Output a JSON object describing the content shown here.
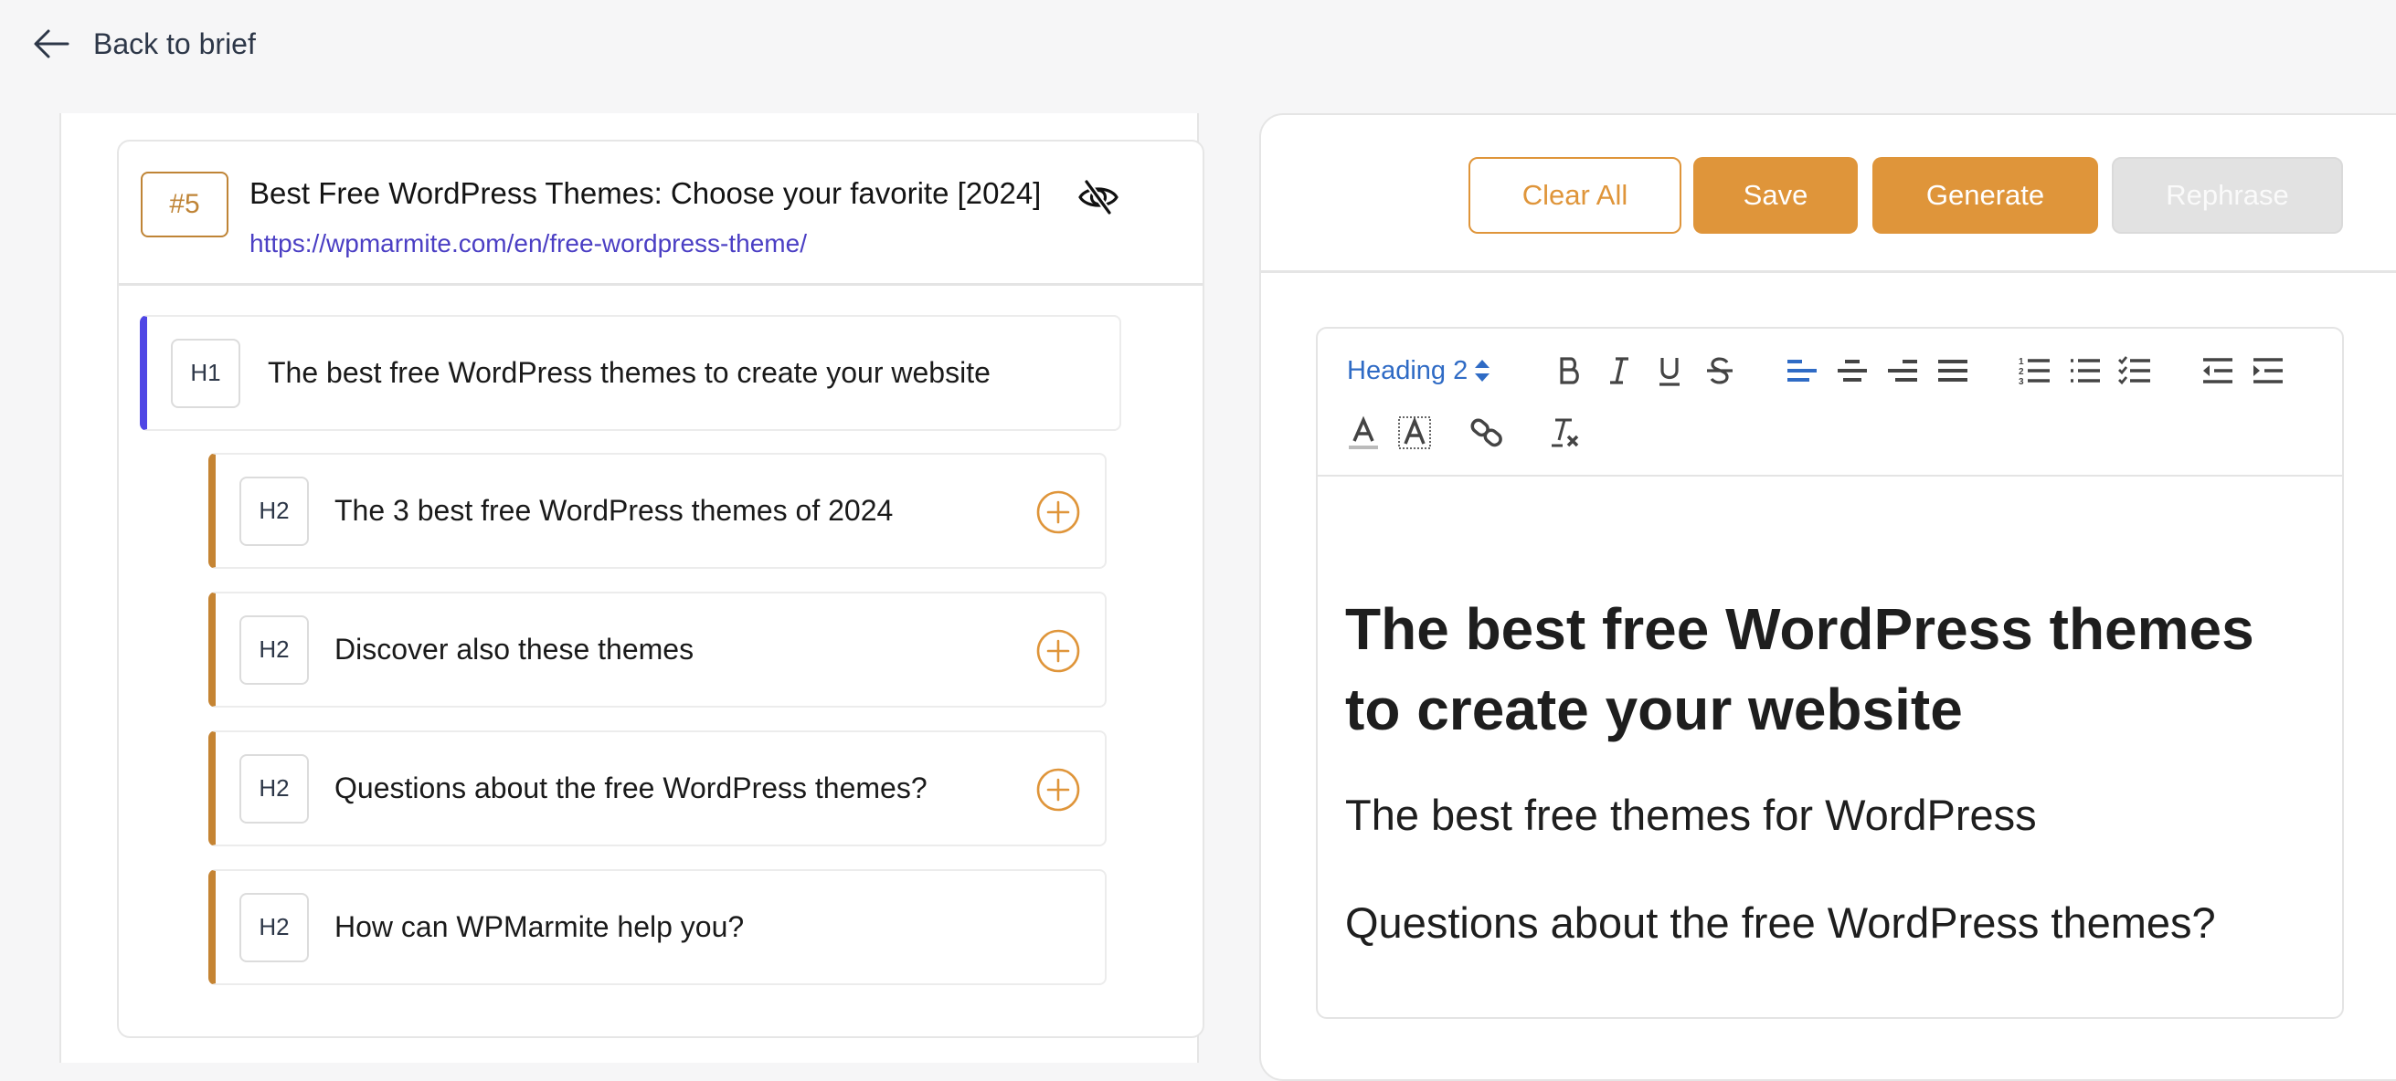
{
  "nav": {
    "back_label": "Back to brief",
    "back_icon": "arrow-left-icon"
  },
  "source": {
    "rank": "#5",
    "title": "Best Free WordPress Themes: Choose your favorite [2024]",
    "url": "https://wpmarmite.com/en/free-wordpress-theme/",
    "visibility_icon": "eye-slash-icon"
  },
  "outline": [
    {
      "level": "H1",
      "text": "The best free WordPress themes to create your website",
      "has_add": false
    },
    {
      "level": "H2",
      "text": "The 3 best free WordPress themes of 2024",
      "has_add": true
    },
    {
      "level": "H2",
      "text": "Discover also these themes",
      "has_add": true
    },
    {
      "level": "H2",
      "text": "Questions about the free WordPress themes?",
      "has_add": true
    },
    {
      "level": "H2",
      "text": "How can WPMarmite help you?",
      "has_add": false
    }
  ],
  "actions": {
    "clear_all": "Clear All",
    "save": "Save",
    "generate": "Generate",
    "rephrase": "Rephrase",
    "rephrase_disabled": true
  },
  "toolbar": {
    "heading_select": "Heading 2",
    "buttons": [
      "bold",
      "italic",
      "underline",
      "strikethrough",
      "align-left",
      "align-center",
      "align-right",
      "align-justify",
      "ordered-list",
      "bullet-list",
      "check-list",
      "outdent",
      "indent",
      "text-color",
      "background-color",
      "link",
      "clear-formatting"
    ],
    "active_button": "align-left"
  },
  "editor": {
    "h1": "The best free WordPress themes to create your website",
    "h2_items": [
      "The best free themes for WordPress",
      "Questions about the free WordPress themes?"
    ]
  },
  "colors": {
    "accent_orange": "#DF953A",
    "h1_marker": "#4F46E5",
    "h2_marker": "#C58433",
    "link": "#4B3FC4",
    "toolbar_active": "#2F6BC5"
  }
}
